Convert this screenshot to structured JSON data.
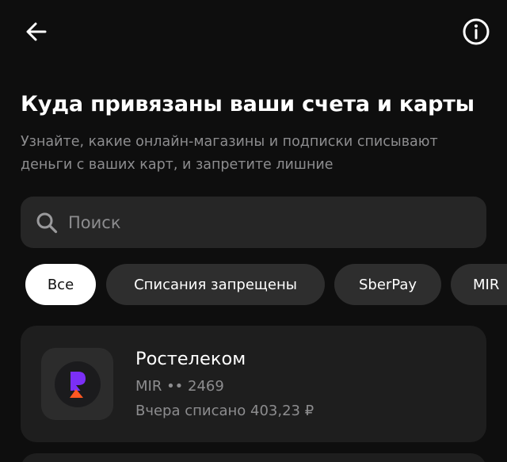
{
  "header": {
    "back_icon": "arrow-left-icon",
    "info_icon": "info-circle-icon"
  },
  "page": {
    "title": "Куда привязаны ваши счета и карты",
    "subtitle": "Узнайте, какие онлайн-магазины и подписки списывают деньги с ваших карт, и запретите лишние"
  },
  "search": {
    "icon": "search-icon",
    "placeholder": "Поиск",
    "value": ""
  },
  "filters": [
    {
      "label": "Все",
      "active": true
    },
    {
      "label": "Списания запрещены",
      "active": false
    },
    {
      "label": "SberPay",
      "active": false
    },
    {
      "label": "MIR",
      "active": false
    }
  ],
  "merchants": [
    {
      "name": "Ростелеком",
      "account": "MIR •• 2469",
      "status": "Вчера списано 403,23 ₽",
      "logo": "rostelecom-logo"
    }
  ],
  "colors": {
    "background": "#0e0e0e",
    "surface": "#1e1e1e",
    "chip": "#2e2e2e",
    "secondary_text": "#8d8d8f",
    "logo_purple": "#7b2ff7",
    "logo_orange": "#ff5722"
  }
}
